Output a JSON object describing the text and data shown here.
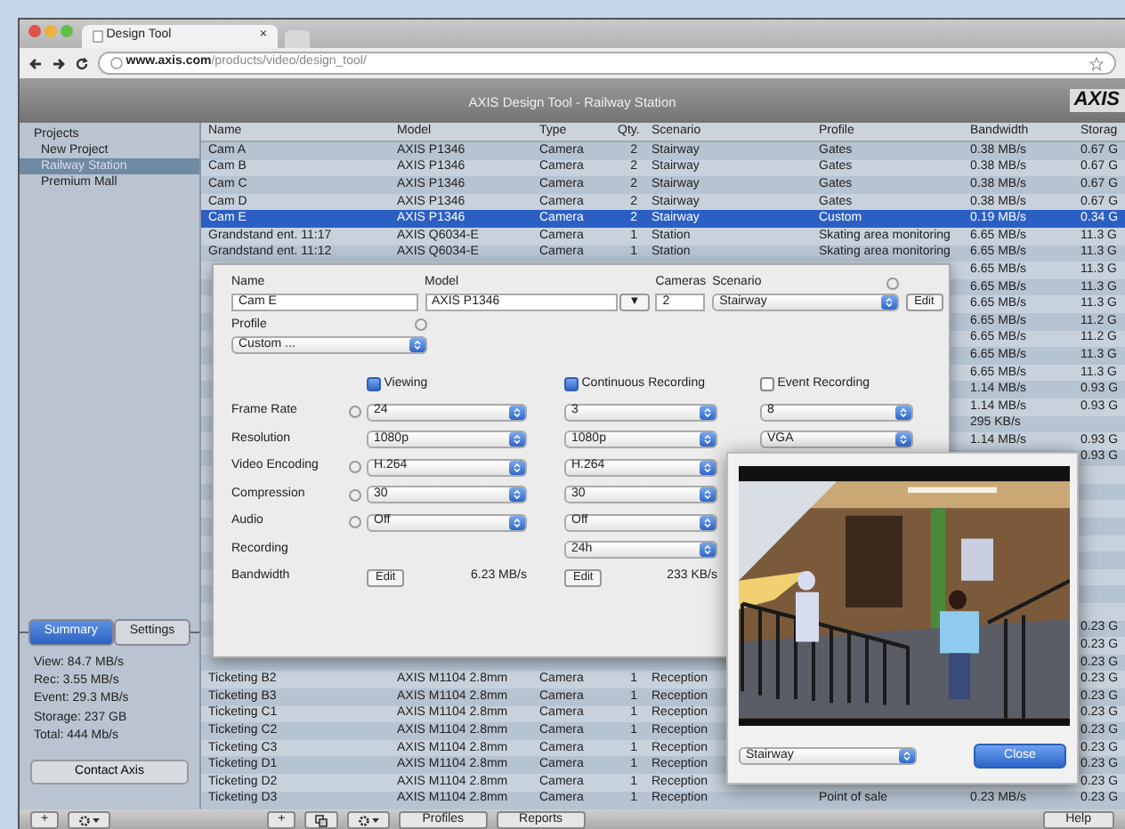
{
  "browser": {
    "tab_title": "Design Tool",
    "tab_close": "×",
    "url_host": "www.axis.com",
    "url_path": "/products/video/design_tool/"
  },
  "app": {
    "title": "AXIS Design Tool - Railway Station",
    "logo": "AXIS"
  },
  "sidebar": {
    "heading": "Projects",
    "items": [
      {
        "label": "New Project",
        "selected": false
      },
      {
        "label": "Railway Station",
        "selected": true
      },
      {
        "label": "Premium Mall",
        "selected": false
      }
    ],
    "tabs": [
      {
        "label": "Summary",
        "selected": true
      },
      {
        "label": "Settings",
        "selected": false
      }
    ],
    "stats": [
      "View: 84.7 MB/s",
      "Rec: 3.55 MB/s",
      "Event: 29.3 MB/s",
      "Storage: 237 GB",
      "Total: 444 Mb/s"
    ],
    "contact_button": "Contact Axis"
  },
  "table": {
    "columns": [
      "Name",
      "Model",
      "Type",
      "Qty.",
      "Scenario",
      "Profile",
      "Bandwidth",
      "Storag"
    ],
    "rows": [
      {
        "name": "Cam A",
        "model": "AXIS P1346",
        "type": "Camera",
        "qty": "2",
        "scenario": "Stairway",
        "profile": "Gates",
        "bandwidth": "0.38 MB/s",
        "storage": "0.67 G",
        "selected": false
      },
      {
        "name": "Cam B",
        "model": "AXIS P1346",
        "type": "Camera",
        "qty": "2",
        "scenario": "Stairway",
        "profile": "Gates",
        "bandwidth": "0.38 MB/s",
        "storage": "0.67 G",
        "selected": false
      },
      {
        "name": "Cam C",
        "model": "AXIS P1346",
        "type": "Camera",
        "qty": "2",
        "scenario": "Stairway",
        "profile": "Gates",
        "bandwidth": "0.38 MB/s",
        "storage": "0.67 G",
        "selected": false
      },
      {
        "name": "Cam D",
        "model": "AXIS P1346",
        "type": "Camera",
        "qty": "2",
        "scenario": "Stairway",
        "profile": "Gates",
        "bandwidth": "0.38 MB/s",
        "storage": "0.67 G",
        "selected": false
      },
      {
        "name": "Cam E",
        "model": "AXIS P1346",
        "type": "Camera",
        "qty": "2",
        "scenario": "Stairway",
        "profile": "Custom",
        "bandwidth": "0.19 MB/s",
        "storage": "0.34 G",
        "selected": true
      },
      {
        "name": "Grandstand ent. 11:17",
        "model": "AXIS Q6034-E",
        "type": "Camera",
        "qty": "1",
        "scenario": "Station",
        "profile": "Skating area monitoring",
        "bandwidth": "6.65 MB/s",
        "storage": "11.3 G",
        "selected": false
      },
      {
        "name": "Grandstand ent. 11:12",
        "model": "AXIS Q6034-E",
        "type": "Camera",
        "qty": "1",
        "scenario": "Station",
        "profile": "Skating area monitoring",
        "bandwidth": "6.65 MB/s",
        "storage": "11.3 G",
        "selected": false
      },
      {
        "bandwidth": "6.65 MB/s",
        "storage": "11.3 G",
        "selected": false
      },
      {
        "bandwidth": "6.65 MB/s",
        "storage": "11.3 G",
        "selected": false
      },
      {
        "bandwidth": "6.65 MB/s",
        "storage": "11.3 G",
        "selected": false
      },
      {
        "bandwidth": "6.65 MB/s",
        "storage": "11.2 G",
        "selected": false
      },
      {
        "bandwidth": "6.65 MB/s",
        "storage": "11.2 G",
        "selected": false
      },
      {
        "bandwidth": "6.65 MB/s",
        "storage": "11.3 G",
        "selected": false
      },
      {
        "bandwidth": "6.65 MB/s",
        "storage": "11.3 G",
        "selected": false
      },
      {
        "bandwidth": "1.14 MB/s",
        "storage": "0.93 G",
        "selected": false
      },
      {
        "bandwidth": "1.14 MB/s",
        "storage": "0.93 G",
        "selected": false
      },
      {
        "bandwidth": "295 KB/s",
        "selected": false
      },
      {
        "bandwidth": "1.14 MB/s",
        "storage": "0.93 G",
        "selected": false
      },
      {
        "storage": "0.93 G",
        "selected": false
      },
      {
        "selected": false
      },
      {
        "selected": false
      },
      {
        "selected": false
      },
      {
        "selected": false
      },
      {
        "selected": false
      },
      {
        "selected": false
      },
      {
        "selected": false
      },
      {
        "selected": false
      },
      {
        "selected": false
      },
      {
        "storage": "0.23 G",
        "selected": false
      },
      {
        "storage": "0.23 G",
        "selected": false
      },
      {
        "storage": "0.23 G",
        "selected": false
      },
      {
        "name": "Ticketing B2",
        "model": "AXIS M1104 2.8mm",
        "type": "Camera",
        "qty": "1",
        "scenario": "Reception",
        "storage": "0.23 G",
        "selected": false
      },
      {
        "name": "Ticketing B3",
        "model": "AXIS M1104 2.8mm",
        "type": "Camera",
        "qty": "1",
        "scenario": "Reception",
        "storage": "0.23 G",
        "selected": false
      },
      {
        "name": "Ticketing C1",
        "model": "AXIS M1104 2.8mm",
        "type": "Camera",
        "qty": "1",
        "scenario": "Reception",
        "storage": "0.23 G",
        "selected": false
      },
      {
        "name": "Ticketing C2",
        "model": "AXIS M1104 2.8mm",
        "type": "Camera",
        "qty": "1",
        "scenario": "Reception",
        "storage": "0.23 G",
        "selected": false
      },
      {
        "name": "Ticketing C3",
        "model": "AXIS M1104 2.8mm",
        "type": "Camera",
        "qty": "1",
        "scenario": "Reception",
        "storage": "0.23 G",
        "selected": false
      },
      {
        "name": "Ticketing D1",
        "model": "AXIS M1104 2.8mm",
        "type": "Camera",
        "qty": "1",
        "scenario": "Reception",
        "storage": "0.23 G",
        "selected": false
      },
      {
        "name": "Ticketing D2",
        "model": "AXIS M1104 2.8mm",
        "type": "Camera",
        "qty": "1",
        "scenario": "Reception",
        "storage": "0.23 G",
        "selected": false
      },
      {
        "name": "Ticketing D3",
        "model": "AXIS M1104 2.8mm",
        "type": "Camera",
        "qty": "1",
        "scenario": "Reception",
        "profile": "Point of sale",
        "bandwidth": "0.23 MB/s",
        "storage": "0.23 G",
        "selected": false
      }
    ]
  },
  "dialog": {
    "name_label": "Name",
    "name_value": "Cam E",
    "model_label": "Model",
    "model_value": "AXIS P1346",
    "model_caret": "▼",
    "cameras_label": "Cameras",
    "cameras_value": "2",
    "scenario_label": "Scenario",
    "scenario_value": "Stairway",
    "edit_label": "Edit",
    "profile_label": "Profile",
    "profile_value": "Custom ...",
    "modes": [
      {
        "label": "Viewing",
        "checked": true
      },
      {
        "label": "Continuous Recording",
        "checked": true
      },
      {
        "label": "Event Recording",
        "checked": false
      }
    ],
    "settings": [
      {
        "label": "Frame Rate",
        "help": true,
        "viewing": "24",
        "continuous": "3",
        "event": "8"
      },
      {
        "label": "Resolution",
        "help": false,
        "viewing": "1080p",
        "continuous": "1080p",
        "event": "VGA"
      },
      {
        "label": "Video Encoding",
        "help": true,
        "viewing": "H.264",
        "continuous": "H.264"
      },
      {
        "label": "Compression",
        "help": true,
        "viewing": "30",
        "continuous": "30"
      },
      {
        "label": "Audio",
        "help": true,
        "viewing": "Off",
        "continuous": "Off"
      },
      {
        "label": "Recording",
        "help": false,
        "continuous": "24h"
      }
    ],
    "bandwidth_label": "Bandwidth",
    "bandwidth": [
      {
        "button": "Edit",
        "value": "6.23 MB/s"
      },
      {
        "button": "Edit",
        "value": "233 KB/s"
      }
    ]
  },
  "preview": {
    "scenario_value": "Stairway",
    "close_button": "Close"
  },
  "toolbar": {
    "left": [
      {
        "kind": "add",
        "label": "+"
      },
      {
        "kind": "action"
      }
    ],
    "middle": [
      {
        "kind": "add",
        "label": "+"
      },
      {
        "kind": "copy"
      },
      {
        "kind": "action"
      },
      {
        "kind": "text",
        "label": "Profiles"
      },
      {
        "kind": "text",
        "label": "Reports"
      }
    ],
    "right": [
      {
        "kind": "text",
        "label": "Help"
      }
    ]
  }
}
